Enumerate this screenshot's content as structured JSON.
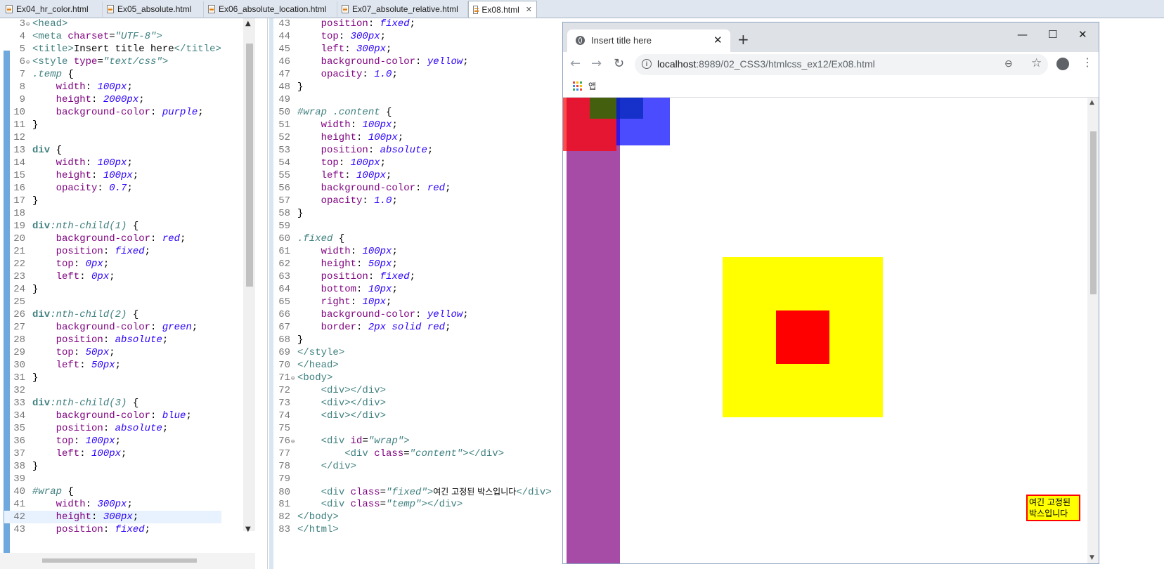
{
  "tabs": [
    {
      "label": "Ex04_hr_color.html"
    },
    {
      "label": "Ex05_absolute.html"
    },
    {
      "label": "Ex06_absolute_location.html"
    },
    {
      "label": "Ex07_absolute_relative.html"
    },
    {
      "label": "Ex08.html",
      "active": true
    }
  ],
  "editor_left": {
    "lines": [
      {
        "n": "3",
        "text": "<head>"
      },
      {
        "n": "4",
        "text": "<meta charset=\"UTF-8\">"
      },
      {
        "n": "5",
        "text": "<title>Insert title here</title>"
      },
      {
        "n": "6",
        "text": "<style type=\"text/css\">"
      },
      {
        "n": "7",
        "text": ".temp {"
      },
      {
        "n": "8",
        "text": "    width: 100px;"
      },
      {
        "n": "9",
        "text": "    height: 2000px;"
      },
      {
        "n": "10",
        "text": "    background-color: purple;"
      },
      {
        "n": "11",
        "text": "}"
      },
      {
        "n": "12",
        "text": ""
      },
      {
        "n": "13",
        "text": "div {"
      },
      {
        "n": "14",
        "text": "    width: 100px;"
      },
      {
        "n": "15",
        "text": "    height: 100px;"
      },
      {
        "n": "16",
        "text": "    opacity: 0.7;"
      },
      {
        "n": "17",
        "text": "}"
      },
      {
        "n": "18",
        "text": ""
      },
      {
        "n": "19",
        "text": "div:nth-child(1) {"
      },
      {
        "n": "20",
        "text": "    background-color: red;"
      },
      {
        "n": "21",
        "text": "    position: fixed;"
      },
      {
        "n": "22",
        "text": "    top: 0px;"
      },
      {
        "n": "23",
        "text": "    left: 0px;"
      },
      {
        "n": "24",
        "text": "}"
      },
      {
        "n": "25",
        "text": ""
      },
      {
        "n": "26",
        "text": "div:nth-child(2) {"
      },
      {
        "n": "27",
        "text": "    background-color: green;"
      },
      {
        "n": "28",
        "text": "    position: absolute;"
      },
      {
        "n": "29",
        "text": "    top: 50px;"
      },
      {
        "n": "30",
        "text": "    left: 50px;"
      },
      {
        "n": "31",
        "text": "}"
      },
      {
        "n": "32",
        "text": ""
      },
      {
        "n": "33",
        "text": "div:nth-child(3) {"
      },
      {
        "n": "34",
        "text": "    background-color: blue;"
      },
      {
        "n": "35",
        "text": "    position: absolute;"
      },
      {
        "n": "36",
        "text": "    top: 100px;"
      },
      {
        "n": "37",
        "text": "    left: 100px;"
      },
      {
        "n": "38",
        "text": "}"
      },
      {
        "n": "39",
        "text": ""
      },
      {
        "n": "40",
        "text": "#wrap {"
      },
      {
        "n": "41",
        "text": "    width: 300px;"
      },
      {
        "n": "42",
        "text": "    height: 300px;"
      },
      {
        "n": "43",
        "text": "    position: fixed;"
      }
    ]
  },
  "editor_right": {
    "lines": [
      {
        "n": "43",
        "text": "    position: fixed;"
      },
      {
        "n": "44",
        "text": "    top: 300px;"
      },
      {
        "n": "45",
        "text": "    left: 300px;"
      },
      {
        "n": "46",
        "text": "    background-color: yellow;"
      },
      {
        "n": "47",
        "text": "    opacity: 1.0;"
      },
      {
        "n": "48",
        "text": "}"
      },
      {
        "n": "49",
        "text": ""
      },
      {
        "n": "50",
        "text": "#wrap .content {"
      },
      {
        "n": "51",
        "text": "    width: 100px;"
      },
      {
        "n": "52",
        "text": "    height: 100px;"
      },
      {
        "n": "53",
        "text": "    position: absolute;"
      },
      {
        "n": "54",
        "text": "    top: 100px;"
      },
      {
        "n": "55",
        "text": "    left: 100px;"
      },
      {
        "n": "56",
        "text": "    background-color: red;"
      },
      {
        "n": "57",
        "text": "    opacity: 1.0;"
      },
      {
        "n": "58",
        "text": "}"
      },
      {
        "n": "59",
        "text": ""
      },
      {
        "n": "60",
        "text": ".fixed {"
      },
      {
        "n": "61",
        "text": "    width: 100px;"
      },
      {
        "n": "62",
        "text": "    height: 50px;"
      },
      {
        "n": "63",
        "text": "    position: fixed;"
      },
      {
        "n": "64",
        "text": "    bottom: 10px;"
      },
      {
        "n": "65",
        "text": "    right: 10px;"
      },
      {
        "n": "66",
        "text": "    background-color: yellow;"
      },
      {
        "n": "67",
        "text": "    border: 2px solid red;"
      },
      {
        "n": "68",
        "text": "}"
      },
      {
        "n": "69",
        "text": "</style>"
      },
      {
        "n": "70",
        "text": "</head>"
      },
      {
        "n": "71",
        "text": "<body>"
      },
      {
        "n": "72",
        "text": "    <div></div>"
      },
      {
        "n": "73",
        "text": "    <div></div>"
      },
      {
        "n": "74",
        "text": "    <div></div>"
      },
      {
        "n": "75",
        "text": ""
      },
      {
        "n": "76",
        "text": "    <div id=\"wrap\">"
      },
      {
        "n": "77",
        "text": "        <div class=\"content\"></div>"
      },
      {
        "n": "78",
        "text": "    </div>"
      },
      {
        "n": "79",
        "text": ""
      },
      {
        "n": "80",
        "text": "    <div class=\"fixed\">여긴 고정된 박스입니다</div>"
      },
      {
        "n": "81",
        "text": "    <div class=\"temp\"></div>"
      },
      {
        "n": "82",
        "text": "</body>"
      },
      {
        "n": "83",
        "text": "</html>"
      }
    ]
  },
  "browser": {
    "tab_title": "Insert title here",
    "url_host": "localhost",
    "url_rest": ":8989/02_CSS3/htmlcss_ex12/Ex08.html",
    "apps_label": "앱",
    "fixed_box_text": "여긴 고정된 박스입니다",
    "colors": {
      "purple": "#800080",
      "red": "#ff0000",
      "green": "#008000",
      "blue": "#0000ff",
      "yellow": "#ffff00"
    }
  }
}
